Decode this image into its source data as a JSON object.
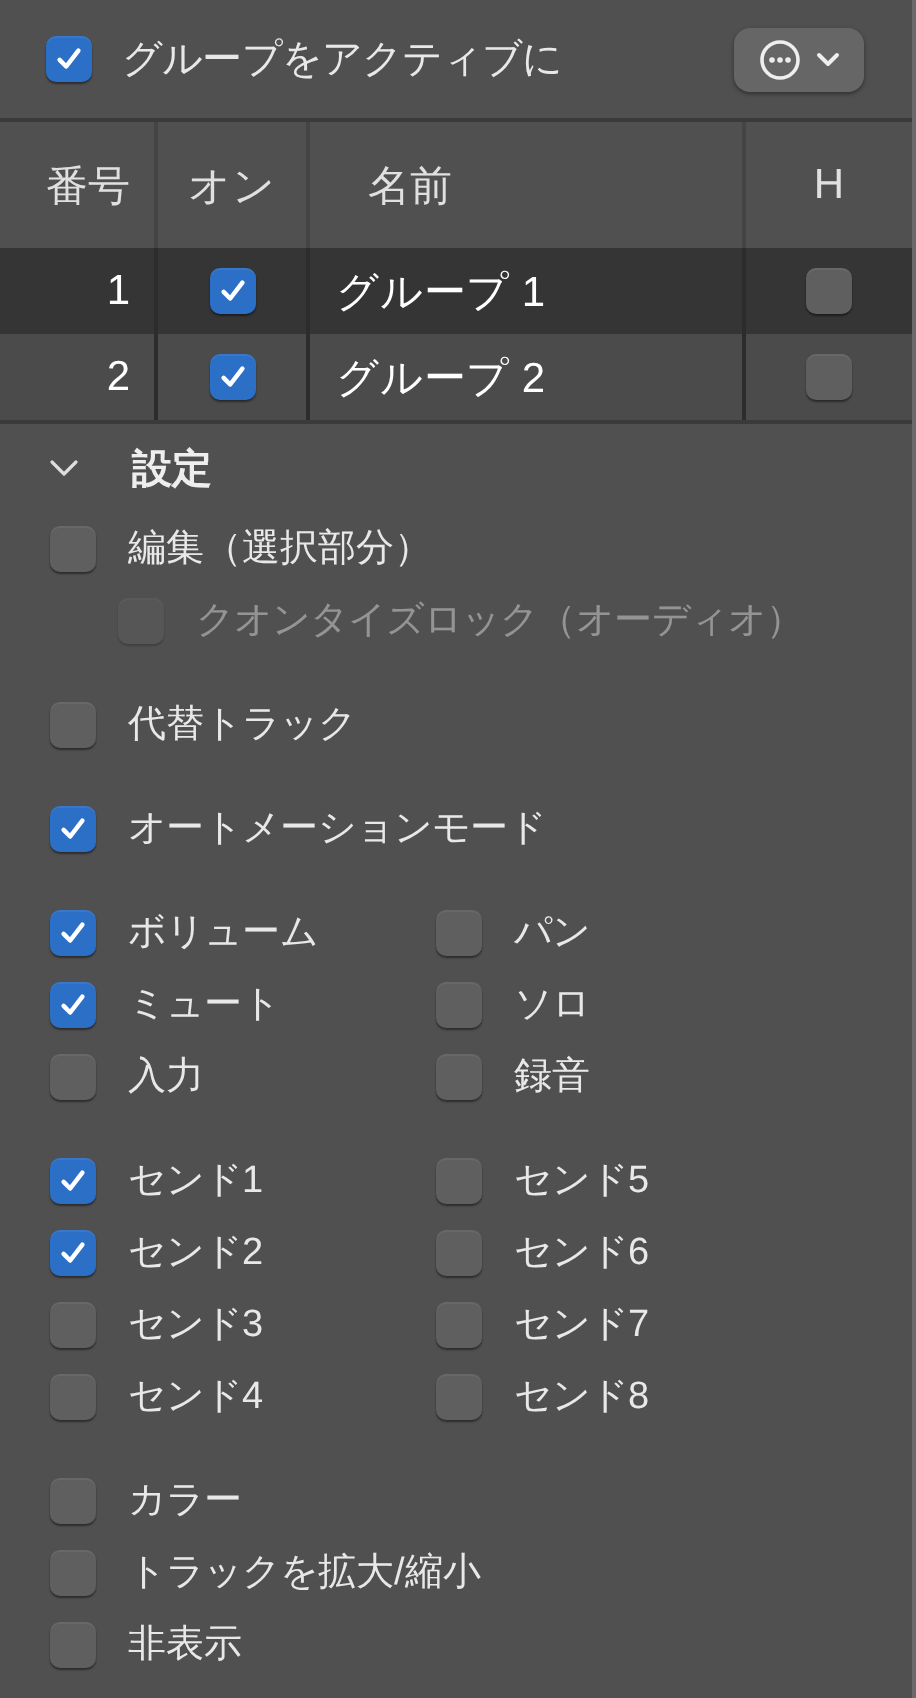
{
  "header": {
    "active": {
      "label": "グループをアクティブに",
      "checked": true
    }
  },
  "table": {
    "columns": [
      "番号",
      "オン",
      "名前",
      "H"
    ],
    "rows": [
      {
        "number": "1",
        "on": true,
        "name": "グループ 1",
        "hide": false,
        "selected": true
      },
      {
        "number": "2",
        "on": true,
        "name": "グループ 2",
        "hide": false,
        "selected": false
      }
    ]
  },
  "settings": {
    "label": "設定",
    "expanded": true,
    "groups": [
      {
        "kind": "list",
        "items": [
          {
            "label": "編集（選択部分）",
            "checked": false,
            "disabled": false,
            "children": [
              {
                "label": "クオンタイズロック（オーディオ）",
                "checked": false,
                "disabled": true
              }
            ]
          }
        ]
      },
      {
        "kind": "list",
        "items": [
          {
            "label": "代替トラック",
            "checked": false,
            "disabled": false
          }
        ]
      },
      {
        "kind": "list",
        "items": [
          {
            "label": "オートメーションモード",
            "checked": true,
            "disabled": false
          }
        ]
      },
      {
        "kind": "grid",
        "items": [
          {
            "label": "ボリューム",
            "checked": true,
            "disabled": false
          },
          {
            "label": "パン",
            "checked": false,
            "disabled": false
          },
          {
            "label": "ミュート",
            "checked": true,
            "disabled": false
          },
          {
            "label": "ソロ",
            "checked": false,
            "disabled": false
          },
          {
            "label": "入力",
            "checked": false,
            "disabled": false
          },
          {
            "label": "録音",
            "checked": false,
            "disabled": false
          }
        ]
      },
      {
        "kind": "grid",
        "items": [
          {
            "label": "センド1",
            "checked": true,
            "disabled": false
          },
          {
            "label": "センド5",
            "checked": false,
            "disabled": false
          },
          {
            "label": "センド2",
            "checked": true,
            "disabled": false
          },
          {
            "label": "センド6",
            "checked": false,
            "disabled": false
          },
          {
            "label": "センド3",
            "checked": false,
            "disabled": false
          },
          {
            "label": "センド7",
            "checked": false,
            "disabled": false
          },
          {
            "label": "センド4",
            "checked": false,
            "disabled": false
          },
          {
            "label": "センド8",
            "checked": false,
            "disabled": false
          }
        ]
      },
      {
        "kind": "list",
        "items": [
          {
            "label": "カラー",
            "checked": false,
            "disabled": false
          },
          {
            "label": "トラックを拡大/縮小",
            "checked": false,
            "disabled": false
          },
          {
            "label": "非表示",
            "checked": false,
            "disabled": false
          }
        ]
      }
    ]
  }
}
